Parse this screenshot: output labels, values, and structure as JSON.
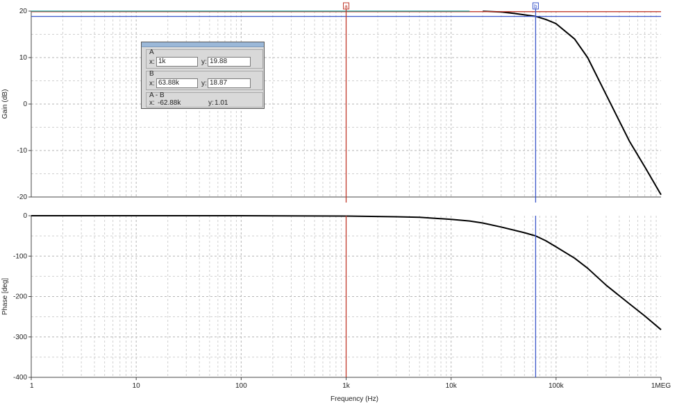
{
  "chart_data": [
    {
      "type": "line",
      "ylabel": "Gain (dB)",
      "xscale": "log",
      "xlim": [
        1,
        1000000
      ],
      "ylim": [
        -20,
        20
      ],
      "grid": true,
      "yticks": [
        20,
        10,
        0,
        -10,
        -20
      ],
      "ytick_labels": [
        "20",
        "10",
        "0",
        "-10",
        "-20"
      ],
      "series": [
        {
          "color": "#000000",
          "x": [
            20000,
            30000,
            40000,
            50000,
            63880,
            80000,
            100000,
            150000,
            200000,
            300000,
            500000,
            700000,
            1000000
          ],
          "y": [
            19.96,
            19.8,
            19.5,
            19.2,
            18.87,
            18.2,
            17.3,
            14.0,
            10.0,
            2.0,
            -8.0,
            -13.5,
            -19.5
          ]
        },
        {
          "color": "#c0392b",
          "x": [
            1,
            1000000
          ],
          "y": [
            19.88,
            19.88
          ]
        },
        {
          "color": "#1aa39a",
          "x": [
            1,
            15000
          ],
          "y": [
            20,
            20
          ]
        },
        {
          "color": "#3a56c9",
          "x": [
            1,
            1000000
          ],
          "y": [
            18.87,
            18.87
          ]
        }
      ],
      "cursors": [
        {
          "name": "a",
          "x": 1000,
          "color": "#c0392b"
        },
        {
          "name": "b",
          "x": 63880,
          "color": "#3a56c9"
        }
      ]
    },
    {
      "type": "line",
      "xlabel": "Frequency (Hz)",
      "ylabel": "Phase [deg]",
      "xscale": "log",
      "xlim": [
        1,
        1000000
      ],
      "ylim": [
        -400,
        0
      ],
      "grid": true,
      "yticks": [
        0,
        -100,
        -200,
        -300,
        -400
      ],
      "ytick_labels": [
        "0",
        "-100",
        "-200",
        "-300",
        "-400"
      ],
      "xticks": [
        1,
        10,
        100,
        1000,
        10000,
        100000,
        1000000
      ],
      "xtick_labels": [
        "1",
        "10",
        "100",
        "1k",
        "10k",
        "100k",
        "1MEG"
      ],
      "series": [
        {
          "color": "#000000",
          "x": [
            1,
            100,
            1000,
            3000,
            5000,
            10000,
            15000,
            20000,
            30000,
            50000,
            63880,
            80000,
            100000,
            150000,
            200000,
            300000,
            500000,
            700000,
            1000000
          ],
          "y": [
            0,
            0,
            -0.8,
            -2.5,
            -4,
            -9,
            -13,
            -18,
            -28,
            -42,
            -50,
            -62,
            -77,
            -105,
            -130,
            -172,
            -218,
            -248,
            -282
          ]
        }
      ],
      "cursors": [
        {
          "name": "a",
          "x": 1000,
          "color": "#c0392b"
        },
        {
          "name": "b",
          "x": 63880,
          "color": "#3a56c9"
        }
      ]
    }
  ],
  "cursor_panel": {
    "a": {
      "title": "A",
      "x_label": "x:",
      "x_value": "1k",
      "y_label": "y:",
      "y_value": "19.88"
    },
    "b": {
      "title": "B",
      "x_label": "x:",
      "x_value": "63.88k",
      "y_label": "y:",
      "y_value": "18.87"
    },
    "diff": {
      "title": "A - B",
      "x_label": "x:",
      "x_value": "-62.88k",
      "y_label": "y:",
      "y_value": "1.01"
    }
  }
}
